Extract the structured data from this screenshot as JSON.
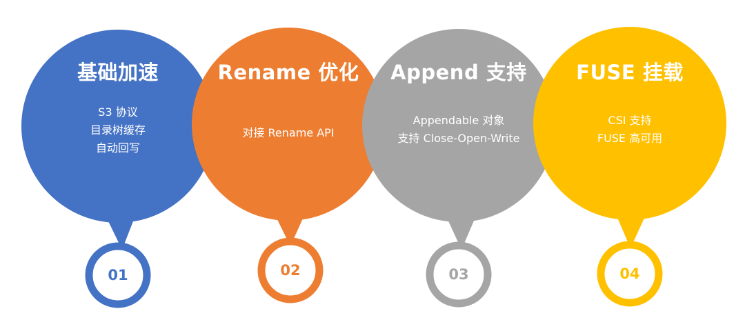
{
  "steps": [
    {
      "title": "基础加速",
      "lines": [
        "S3 协议",
        "目录树缓存",
        "自动回写"
      ],
      "number": "01",
      "color": "#4472C4"
    },
    {
      "title": "Rename 优化",
      "lines": [
        "对接 Rename API"
      ],
      "number": "02",
      "color": "#ED7D31"
    },
    {
      "title": "Append 支持",
      "lines": [
        "Appendable 对象",
        "支持 Close-Open-Write"
      ],
      "number": "03",
      "color": "#A5A5A5"
    },
    {
      "title": "FUSE 挂载",
      "lines": [
        "CSI 支持",
        "FUSE 高可用"
      ],
      "number": "04",
      "color": "#FFC000"
    }
  ]
}
